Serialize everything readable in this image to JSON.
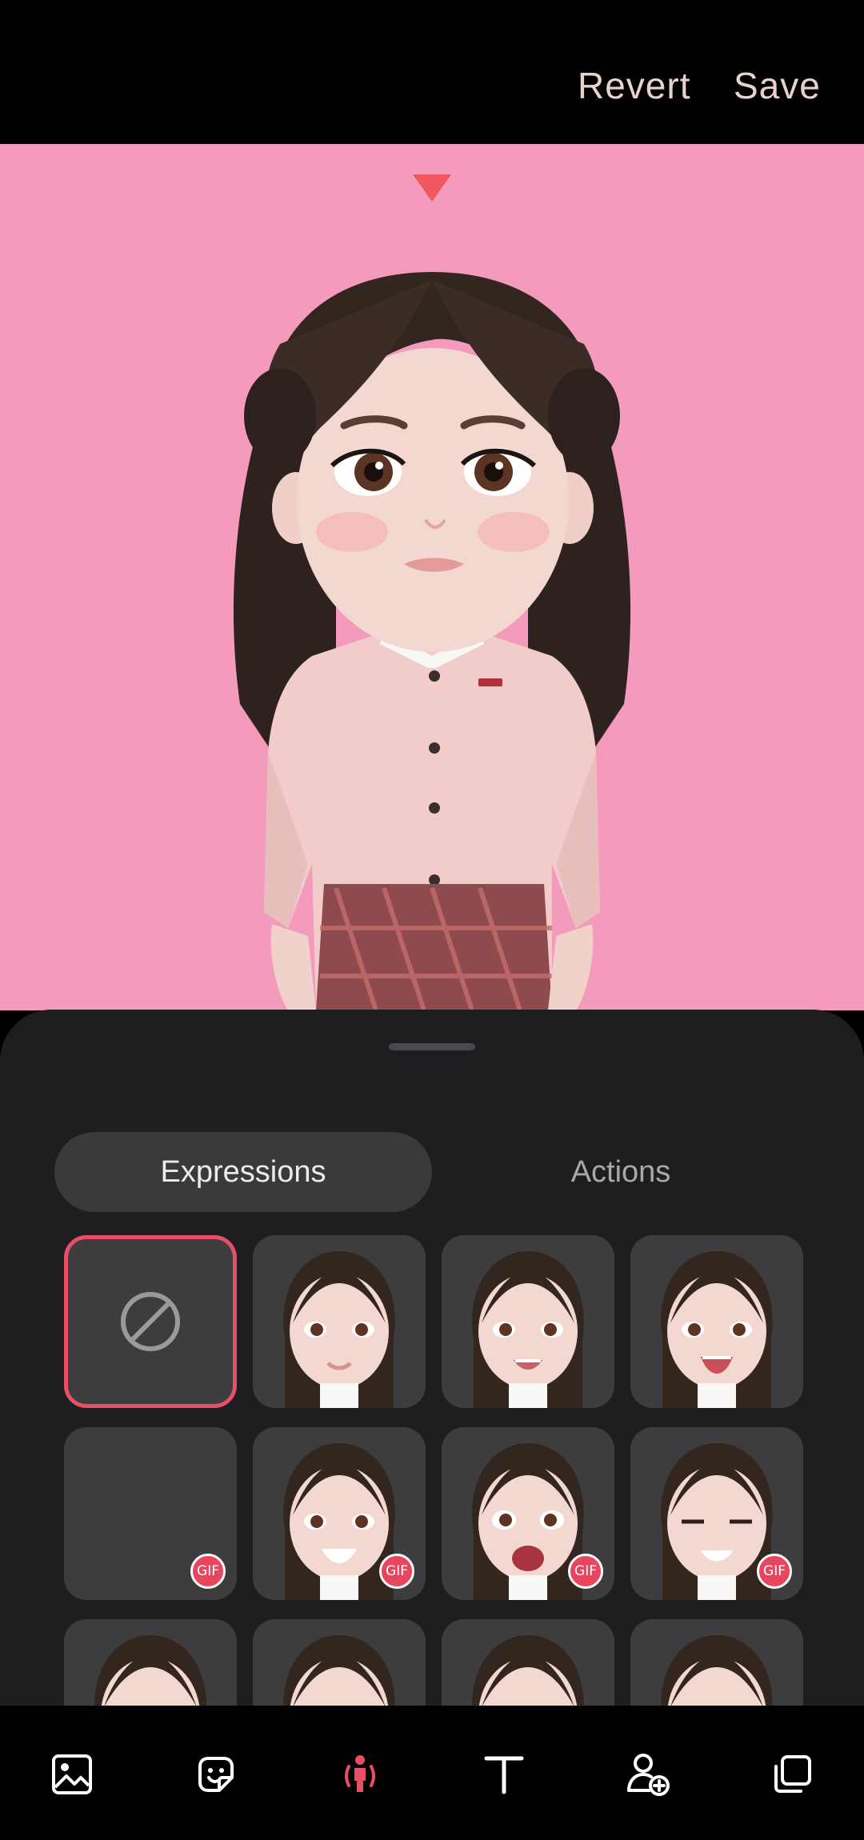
{
  "header": {
    "revert_label": "Revert",
    "save_label": "Save"
  },
  "colors": {
    "background": "#000000",
    "stage": "#F39ABD",
    "panel": "#1E1E21",
    "accent": "#E84F66",
    "text_primary": "#E8D3CC"
  },
  "panel": {
    "tabs": [
      {
        "label": "Expressions",
        "selected": true
      },
      {
        "label": "Actions",
        "selected": false
      }
    ],
    "grid": [
      {
        "type": "none",
        "icon": "no-expression-icon",
        "selected": true
      },
      {
        "type": "expression",
        "gif": false
      },
      {
        "type": "expression",
        "gif": false
      },
      {
        "type": "expression",
        "gif": false
      },
      {
        "type": "empty",
        "gif": true,
        "gif_label": "GIF"
      },
      {
        "type": "expression",
        "gif": true,
        "gif_label": "GIF"
      },
      {
        "type": "expression",
        "gif": true,
        "gif_label": "GIF"
      },
      {
        "type": "expression",
        "gif": true,
        "gif_label": "GIF"
      },
      {
        "type": "expression",
        "gif": false
      },
      {
        "type": "expression",
        "gif": false
      },
      {
        "type": "expression",
        "gif": false
      },
      {
        "type": "expression",
        "gif": false
      }
    ]
  },
  "navbar": {
    "items": [
      {
        "icon": "gallery-icon",
        "active": false
      },
      {
        "icon": "sticker-icon",
        "active": false
      },
      {
        "icon": "avatar-pose-icon",
        "active": true
      },
      {
        "icon": "text-icon",
        "active": false
      },
      {
        "icon": "add-person-icon",
        "active": false
      },
      {
        "icon": "layers-icon",
        "active": false
      }
    ]
  }
}
